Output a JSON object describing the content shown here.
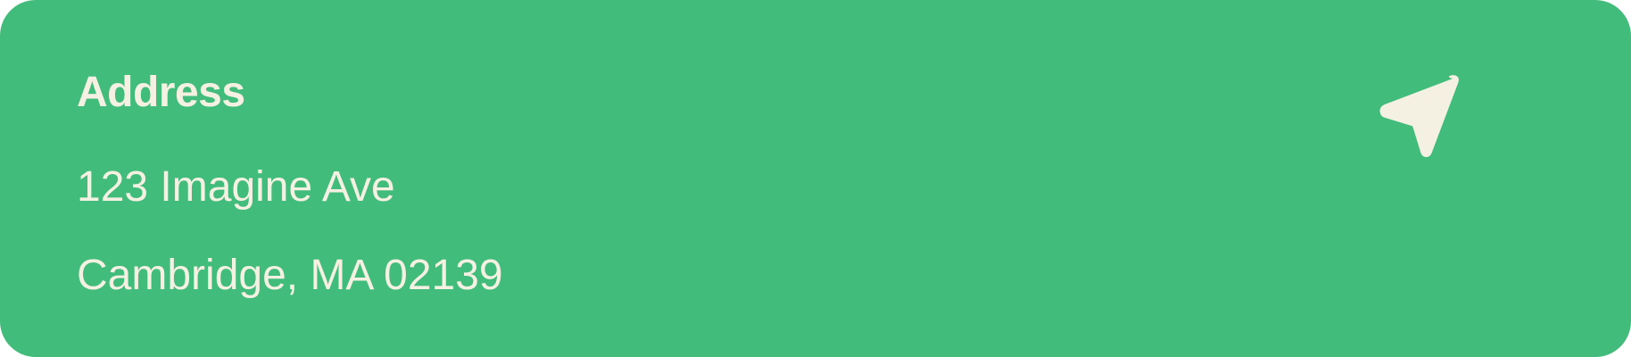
{
  "card": {
    "title": "Address",
    "address_line_1": "123 Imagine Ave",
    "address_line_2": "Cambridge, MA 02139",
    "icon": "navigation-arrow-icon",
    "colors": {
      "background": "#42bc7b",
      "text": "#f4f1e3"
    }
  }
}
